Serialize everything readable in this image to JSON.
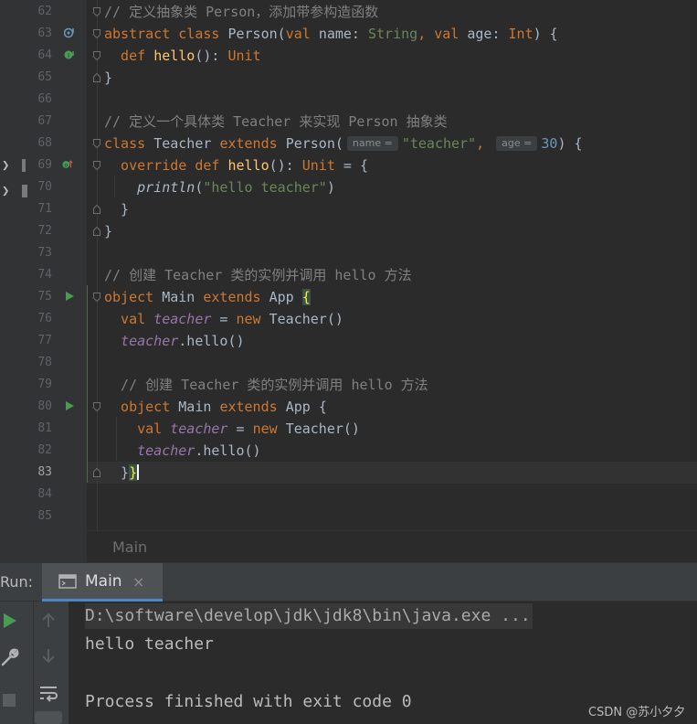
{
  "editor": {
    "lines": [
      {
        "n": "62",
        "tokens": [
          {
            "t": "// 定义抽象类 Person，添加带参构造函数",
            "c": "cm"
          }
        ]
      },
      {
        "n": "63",
        "tokens": [
          {
            "t": "abstract class ",
            "c": "kw"
          },
          {
            "t": "Person(",
            "c": ""
          },
          {
            "t": "val ",
            "c": "kw"
          },
          {
            "t": "name: ",
            "c": ""
          },
          {
            "t": "String",
            "c": "str"
          },
          {
            "t": ", ",
            "c": "kw"
          },
          {
            "t": "val ",
            "c": "kw"
          },
          {
            "t": "age: ",
            "c": ""
          },
          {
            "t": "Int",
            "c": "kw"
          },
          {
            "t": ") {",
            "c": ""
          }
        ]
      },
      {
        "n": "64",
        "tokens": [
          {
            "t": "  def ",
            "c": "kw"
          },
          {
            "t": "hello",
            "c": "fn"
          },
          {
            "t": "(): ",
            "c": ""
          },
          {
            "t": "Unit",
            "c": "kw"
          }
        ]
      },
      {
        "n": "65",
        "tokens": [
          {
            "t": "}",
            "c": ""
          }
        ]
      },
      {
        "n": "66",
        "tokens": []
      },
      {
        "n": "67",
        "tokens": [
          {
            "t": "// 定义一个具体类 Teacher 来实现 Person 抽象类",
            "c": "cm"
          }
        ]
      },
      {
        "n": "68",
        "tokens": [
          {
            "t": "class ",
            "c": "kw"
          },
          {
            "t": "Teacher ",
            "c": ""
          },
          {
            "t": "extends ",
            "c": "kw"
          },
          {
            "t": "Person(",
            "c": ""
          },
          {
            "t": "name =",
            "c": "hint"
          },
          {
            "t": "\"teacher\"",
            "c": "str"
          },
          {
            "t": ", ",
            "c": "kw"
          },
          {
            "t": "age =",
            "c": "hint"
          },
          {
            "t": "30",
            "c": "num"
          },
          {
            "t": ") {",
            "c": ""
          }
        ]
      },
      {
        "n": "69",
        "tokens": [
          {
            "t": "  override def ",
            "c": "kw"
          },
          {
            "t": "hello",
            "c": "fn"
          },
          {
            "t": "(): ",
            "c": ""
          },
          {
            "t": "Unit ",
            "c": "kw"
          },
          {
            "t": "= {",
            "c": ""
          }
        ]
      },
      {
        "n": "70",
        "tokens": [
          {
            "t": "    ",
            "c": ""
          },
          {
            "t": "println",
            "c": "it"
          },
          {
            "t": "(",
            "c": ""
          },
          {
            "t": "\"hello teacher\"",
            "c": "str"
          },
          {
            "t": ")",
            "c": ""
          }
        ]
      },
      {
        "n": "71",
        "tokens": [
          {
            "t": "  }",
            "c": ""
          }
        ]
      },
      {
        "n": "72",
        "tokens": [
          {
            "t": "}",
            "c": ""
          }
        ]
      },
      {
        "n": "73",
        "tokens": []
      },
      {
        "n": "74",
        "tokens": [
          {
            "t": "// 创建 Teacher 类的实例并调用 hello 方法",
            "c": "cm"
          }
        ]
      },
      {
        "n": "75",
        "tokens": [
          {
            "t": "object ",
            "c": "kw"
          },
          {
            "t": "Main ",
            "c": ""
          },
          {
            "t": "extends ",
            "c": "kw"
          },
          {
            "t": "App ",
            "c": ""
          },
          {
            "t": "{",
            "c": "bracehl"
          }
        ]
      },
      {
        "n": "76",
        "tokens": [
          {
            "t": "  val ",
            "c": "kw"
          },
          {
            "t": "teacher",
            "c": "prop"
          },
          {
            "t": " = ",
            "c": ""
          },
          {
            "t": "new ",
            "c": "kw"
          },
          {
            "t": "Teacher()",
            "c": ""
          }
        ]
      },
      {
        "n": "77",
        "tokens": [
          {
            "t": "  ",
            "c": ""
          },
          {
            "t": "teacher",
            "c": "prop"
          },
          {
            "t": ".hello()",
            "c": ""
          }
        ]
      },
      {
        "n": "78",
        "tokens": []
      },
      {
        "n": "79",
        "tokens": [
          {
            "t": "  // 创建 Teacher 类的实例并调用 hello 方法",
            "c": "cm"
          }
        ]
      },
      {
        "n": "80",
        "tokens": [
          {
            "t": "  object ",
            "c": "kw"
          },
          {
            "t": "Main ",
            "c": ""
          },
          {
            "t": "extends ",
            "c": "kw"
          },
          {
            "t": "App ",
            "c": ""
          },
          {
            "t": "{",
            "c": ""
          }
        ]
      },
      {
        "n": "81",
        "tokens": [
          {
            "t": "    val ",
            "c": "kw"
          },
          {
            "t": "teacher",
            "c": "prop"
          },
          {
            "t": " = ",
            "c": ""
          },
          {
            "t": "new ",
            "c": "kw"
          },
          {
            "t": "Teacher()",
            "c": ""
          }
        ]
      },
      {
        "n": "82",
        "tokens": [
          {
            "t": "    ",
            "c": ""
          },
          {
            "t": "teacher",
            "c": "prop"
          },
          {
            "t": ".hello()",
            "c": ""
          }
        ]
      },
      {
        "n": "83",
        "tokens": [
          {
            "t": "  }",
            "c": ""
          },
          {
            "t": "}",
            "c": "bracehl"
          },
          {
            "t": "",
            "c": "caret"
          }
        ]
      },
      {
        "n": "84",
        "tokens": []
      },
      {
        "n": "85",
        "tokens": []
      }
    ],
    "current_line": "83"
  },
  "breadcrumb": {
    "label": "Main"
  },
  "run_panel": {
    "label": "Run:",
    "tab_label": "Main",
    "close_glyph": "×",
    "console": {
      "command": "D:\\software\\develop\\jdk\\jdk8\\bin\\java.exe ...",
      "output": "hello teacher",
      "status": "Process finished with exit code 0"
    }
  },
  "watermark": "CSDN @苏小夕夕",
  "colors": {
    "editor_bg": "#2b2b2b",
    "keyword": "#cc7832",
    "comment": "#808080",
    "string": "#6a8759",
    "number": "#6897bb",
    "function": "#ffc66d",
    "property": "#9876aa",
    "run_green": "#499c54",
    "tab_underline": "#4a88c7"
  }
}
